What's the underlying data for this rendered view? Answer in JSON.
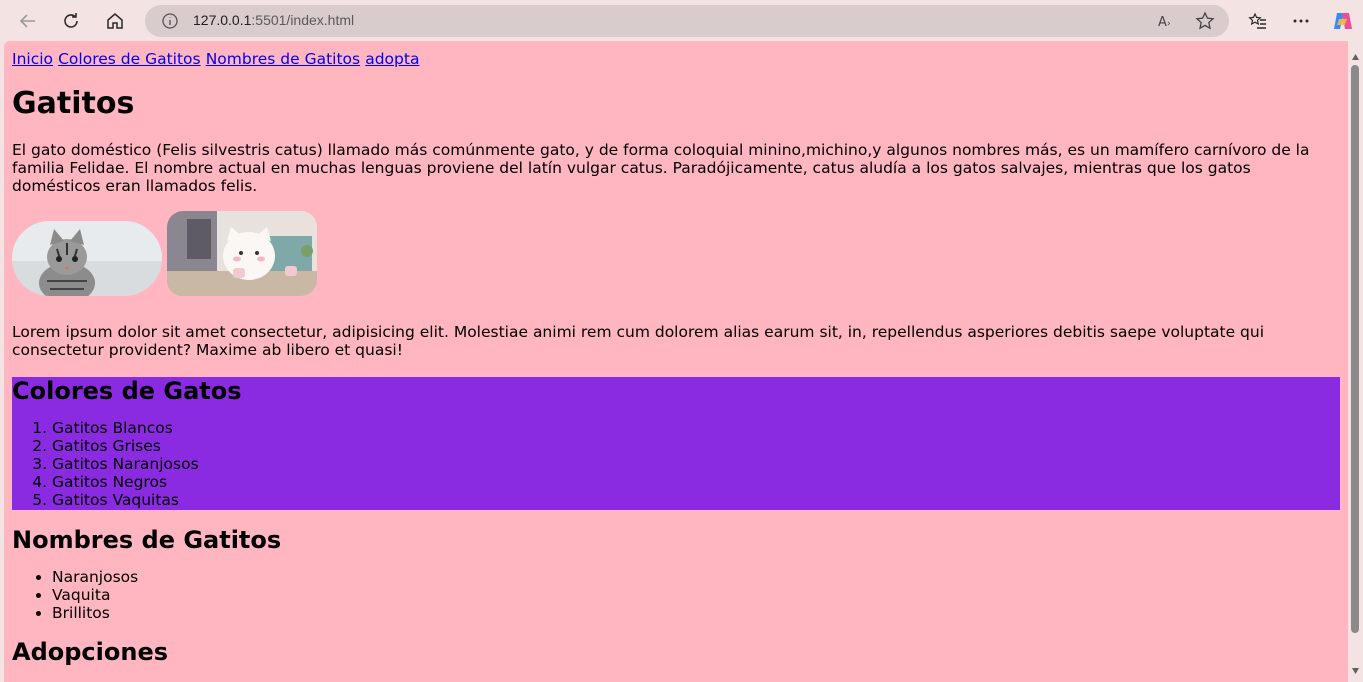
{
  "browser": {
    "url_host": "127.0.0.1",
    "url_rest": ":5501/index.html"
  },
  "nav": [
    "Inicio",
    "Colores de Gatitos",
    "Nombres de Gatitos",
    "adopta"
  ],
  "page": {
    "title": "Gatitos",
    "intro": "El gato doméstico (Felis silvestris catus) llamado más comúnmente gato, y de forma coloquial minino,michino,y algunos nombres más, es un mamífero carnívoro de la familia Felidae. El nombre actual en muchas lenguas proviene del latín vulgar catus. Paradójicamente, catus aludía a los gatos salvajes, mientras que los gatos domésticos eran llamados felis.",
    "lorem": "Lorem ipsum dolor sit amet consectetur, adipisicing elit. Molestiae animi rem cum dolorem alias earum sit, in, repellendus asperiores debitis saepe voluptate qui consectetur provident? Maxime ab libero et quasi!",
    "colores": {
      "heading": "Colores de Gatos",
      "items": [
        "Gatitos Blancos",
        "Gatitos Grises",
        "Gatitos Naranjosos",
        "Gatitos Negros",
        "Gatitos Vaquitas"
      ],
      "bg_color": "#8a2be2"
    },
    "nombres": {
      "heading": "Nombres de Gatitos",
      "items": [
        "Naranjosos",
        "Vaquita",
        "Brillitos"
      ]
    },
    "adopciones_heading": "Adopciones",
    "bg_color": "#ffb6c1"
  }
}
